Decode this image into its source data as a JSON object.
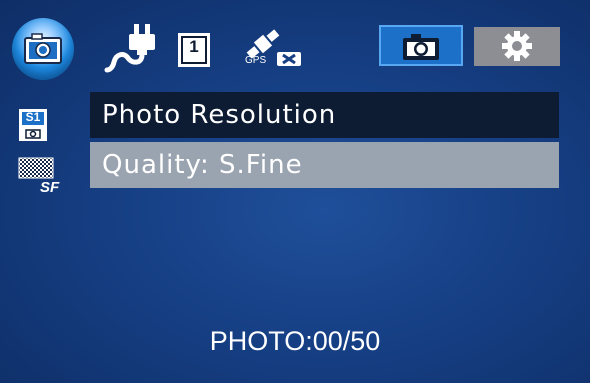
{
  "status_bar": {
    "mode_icon": "camera-icon",
    "power_icon": "plug-icon",
    "sd_icon": "sd-card-icon",
    "sd_number": "1",
    "gps_icon": "gps-off-icon",
    "gps_label": "GPS"
  },
  "tabs": {
    "camera_icon": "camera-icon",
    "settings_icon": "gear-icon"
  },
  "side_icons": {
    "resolution_icon": "S1",
    "quality_icon_label": "SF"
  },
  "menu": {
    "title": "Photo Resolution",
    "selected_item": "Quality: S.Fine"
  },
  "footer": {
    "photo_count": "PHOTO:00/50"
  },
  "colors": {
    "background": "#163f84",
    "title_row": "#0d1b33",
    "selected_row": "#9aa3b0",
    "active_tab": "#1d70c8",
    "inactive_tab": "#8d8d94"
  }
}
